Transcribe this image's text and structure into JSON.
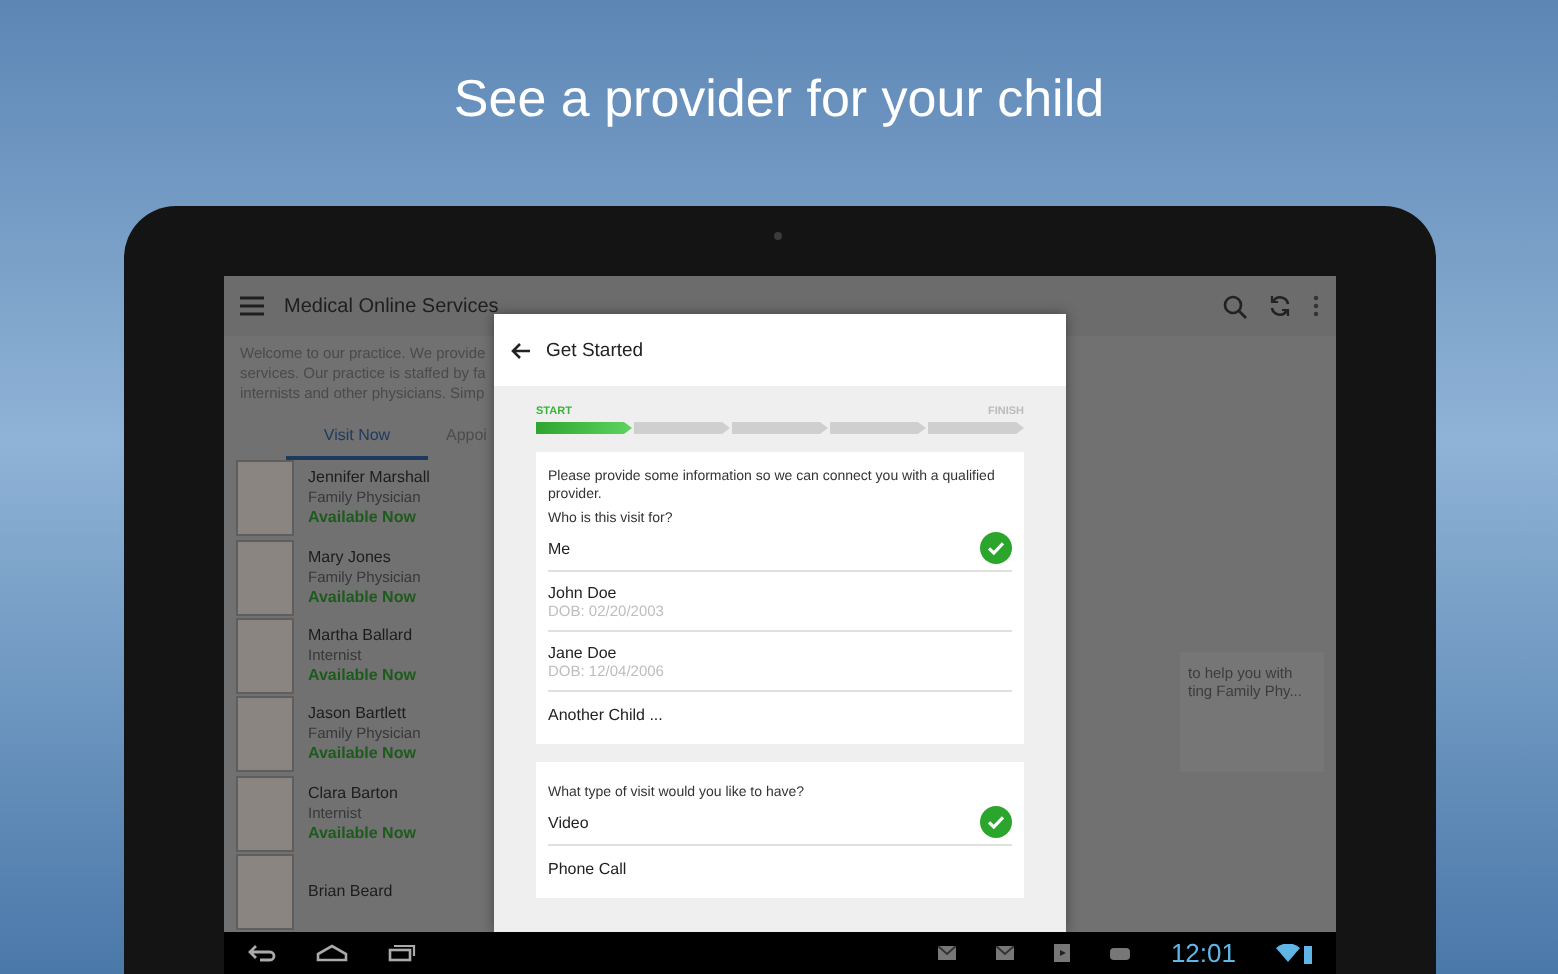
{
  "headline": "See a provider for your child",
  "app": {
    "title": "Medical Online Services",
    "intro_lines": [
      "Welcome to our practice. We provide",
      "services. Our practice is staffed by fa",
      "internists and other physicians. Simp"
    ],
    "tabs": [
      {
        "label": "Visit Now",
        "selected": true
      },
      {
        "label": "Appoi",
        "selected": false
      }
    ],
    "providers": [
      {
        "name": "Jennifer Marshall",
        "specialty": "Family Physician",
        "status": "Available Now"
      },
      {
        "name": "Mary Jones",
        "specialty": "Family Physician",
        "status": "Available Now"
      },
      {
        "name": "Martha Ballard",
        "specialty": "Internist",
        "status": "Available Now"
      },
      {
        "name": "Jason Bartlett",
        "specialty": "Family Physician",
        "status": "Available Now"
      },
      {
        "name": "Clara Barton",
        "specialty": "Internist",
        "status": "Available Now"
      },
      {
        "name": "Brian Beard"
      }
    ],
    "side_card": {
      "lines": [
        "to help you with",
        "ting Family Phy..."
      ]
    }
  },
  "dialog": {
    "title": "Get Started",
    "progress": {
      "start_label": "START",
      "finish_label": "FINISH",
      "steps": [
        {
          "completed": true
        },
        {
          "completed": false
        },
        {
          "completed": false
        },
        {
          "completed": false
        },
        {
          "completed": false
        }
      ]
    },
    "intro": "Please provide some information so we can connect you with a qualified provider.",
    "patient_question": "Who is this visit for?",
    "patients": [
      {
        "name": "Me",
        "selected": true
      },
      {
        "name": "John Doe",
        "dob": "DOB: 02/20/2003",
        "selected": false
      },
      {
        "name": "Jane Doe",
        "dob": "DOB: 12/04/2006",
        "selected": false
      },
      {
        "name": "Another Child ...",
        "selected": false
      }
    ],
    "visit_question": "What type of visit would you like to have?",
    "visit_types": [
      {
        "name": "Video",
        "selected": true
      },
      {
        "name": "Phone Call",
        "selected": false
      }
    ]
  },
  "status_bar": {
    "time": "12:01"
  }
}
